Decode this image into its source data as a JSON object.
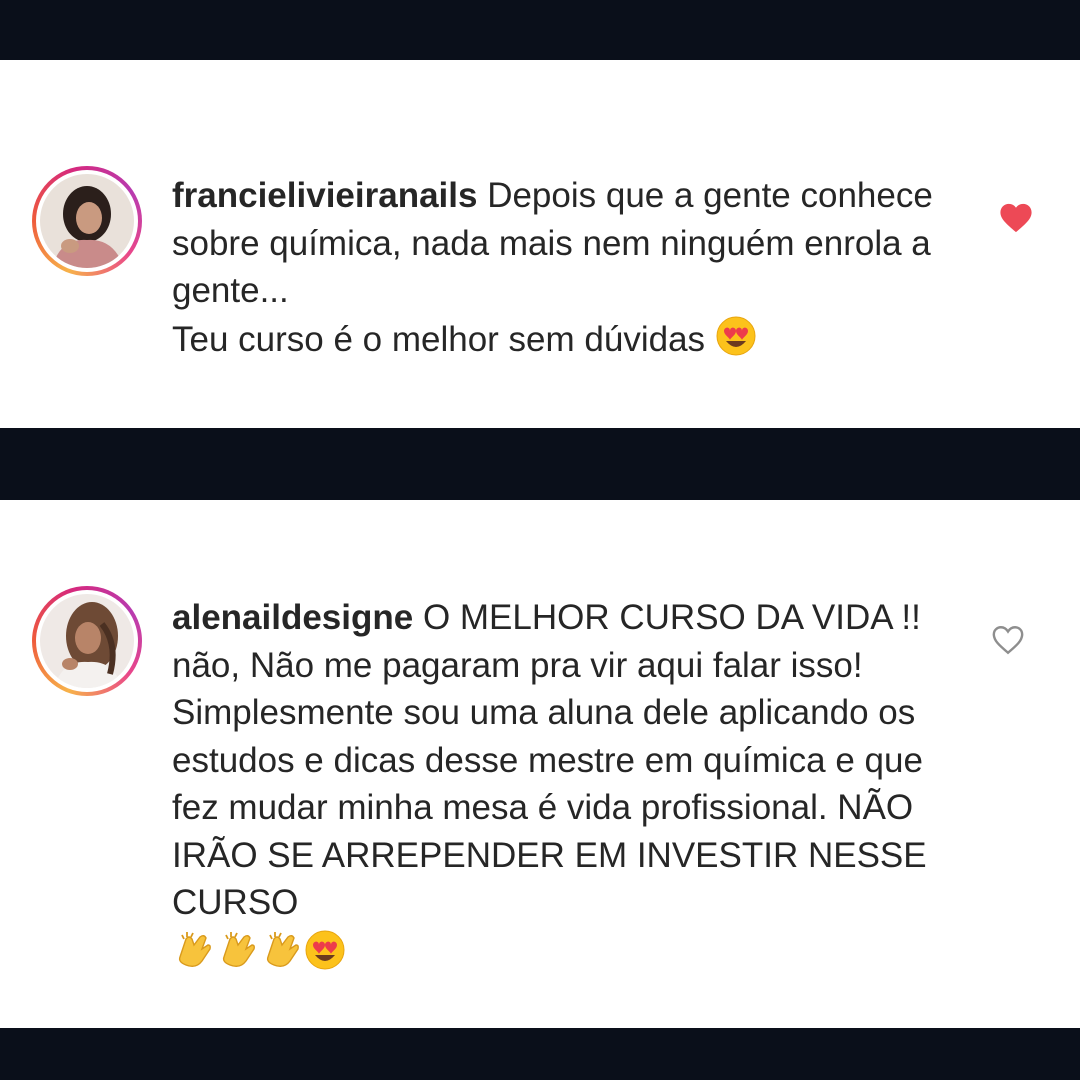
{
  "comments": [
    {
      "username": "francielivieiranails",
      "text": "Depois que a gente conhece sobre química, nada mais nem ninguém enrola a gente...\nTeu curso é o melhor sem dúvidas",
      "trailing_emoji": [
        "heart-eyes"
      ],
      "liked": true,
      "like_color": "#ed4956"
    },
    {
      "username": "alenaildesigne",
      "text": "O MELHOR CURSO DA VIDA !! não, Não me pagaram pra vir aqui falar isso! Simplesmente sou uma aluna dele aplicando os estudos e dicas desse mestre em química e que fez mudar minha mesa é vida profissional. NÃO  IRÃO SE ARREPENDER EM INVESTIR NESSE CURSO",
      "trailing_emoji": [
        "clapping-hands",
        "clapping-hands",
        "clapping-hands",
        "heart-eyes"
      ],
      "liked": false,
      "like_color": "#8e8e8e"
    }
  ],
  "colors": {
    "background_band": "#0a0f1a",
    "card": "#ffffff",
    "text": "#262626"
  }
}
